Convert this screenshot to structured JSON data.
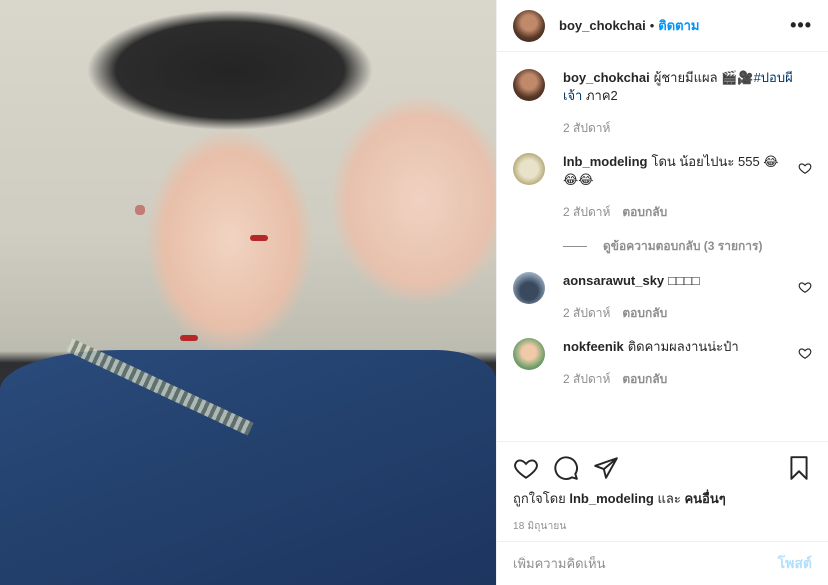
{
  "header": {
    "username": "boy_chokchai",
    "separator": "•",
    "follow_label": "ติดตาม",
    "more_label": "•••",
    "avatar_icon": "profile-photo"
  },
  "caption": {
    "username": "boy_chokchai",
    "text": "ผู้ชายมีแผล 🎬🎥",
    "hashtag": "#ปอบผีเจ้า",
    "suffix": " ภาค2",
    "time": "2 สัปดาห์"
  },
  "comments": [
    {
      "username": "lnb_modeling",
      "text": "โดน น้อยไปนะ 555 😂😂😂",
      "time": "2 สัปดาห์",
      "reply_label": "ตอบกลับ"
    },
    {
      "username": "aonsarawut_sky",
      "text": "□□□□",
      "time": "2 สัปดาห์",
      "reply_label": "ตอบกลับ"
    },
    {
      "username": "nokfeenik",
      "text": "ติดคามผลงานน่ะป๋า",
      "time": "2 สัปดาห์",
      "reply_label": "ตอบกลับ"
    }
  ],
  "view_replies": "ดูข้อความตอบกลับ (3 รายการ)",
  "likes": {
    "prefix": "ถูกใจโดย",
    "user": "lnb_modeling",
    "and": "และ",
    "others": "คนอื่นๆ"
  },
  "date": "18 มิถุนายน",
  "add_comment": {
    "placeholder": "เพิ่มความคิดเห็น",
    "post_label": "โพสต์"
  },
  "icons": [
    "heart-icon",
    "comment-icon",
    "share-icon",
    "bookmark-icon",
    "more-icon"
  ],
  "colors": {
    "link": "#0095f6",
    "hashtag": "#00376b",
    "muted": "#8e8e8e",
    "post_disabled": "#b2dffc"
  }
}
